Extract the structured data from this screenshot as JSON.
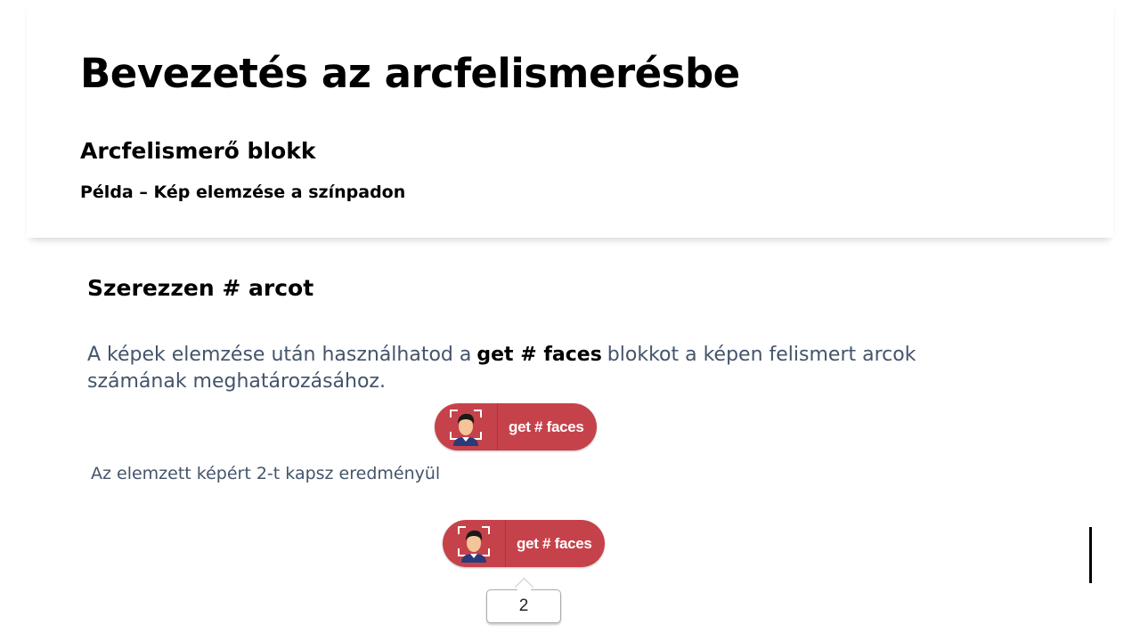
{
  "slide": {
    "title": "Bevezetés az arcfelismerésbe",
    "subtitle": "Arcfelismerő blokk",
    "subsubtitle": "Példa – Kép elemzése  a színpadon",
    "section_heading": "Szerezzen # arcot",
    "body_before": "A képek elemzése után használhatod a",
    "body_bold": "get # faces",
    "body_after": "blokkot a képen felismert arcok számának meghatározásához.",
    "result_text": "Az elemzett képért 2-t kapsz eredményül"
  },
  "blocks": [
    {
      "label": "get # faces",
      "icon": "face-recognition-icon",
      "color": "#c6424a"
    },
    {
      "label": "get # faces",
      "icon": "face-recognition-icon",
      "color": "#c6424a"
    }
  ],
  "result_bubble": {
    "value": "2"
  }
}
